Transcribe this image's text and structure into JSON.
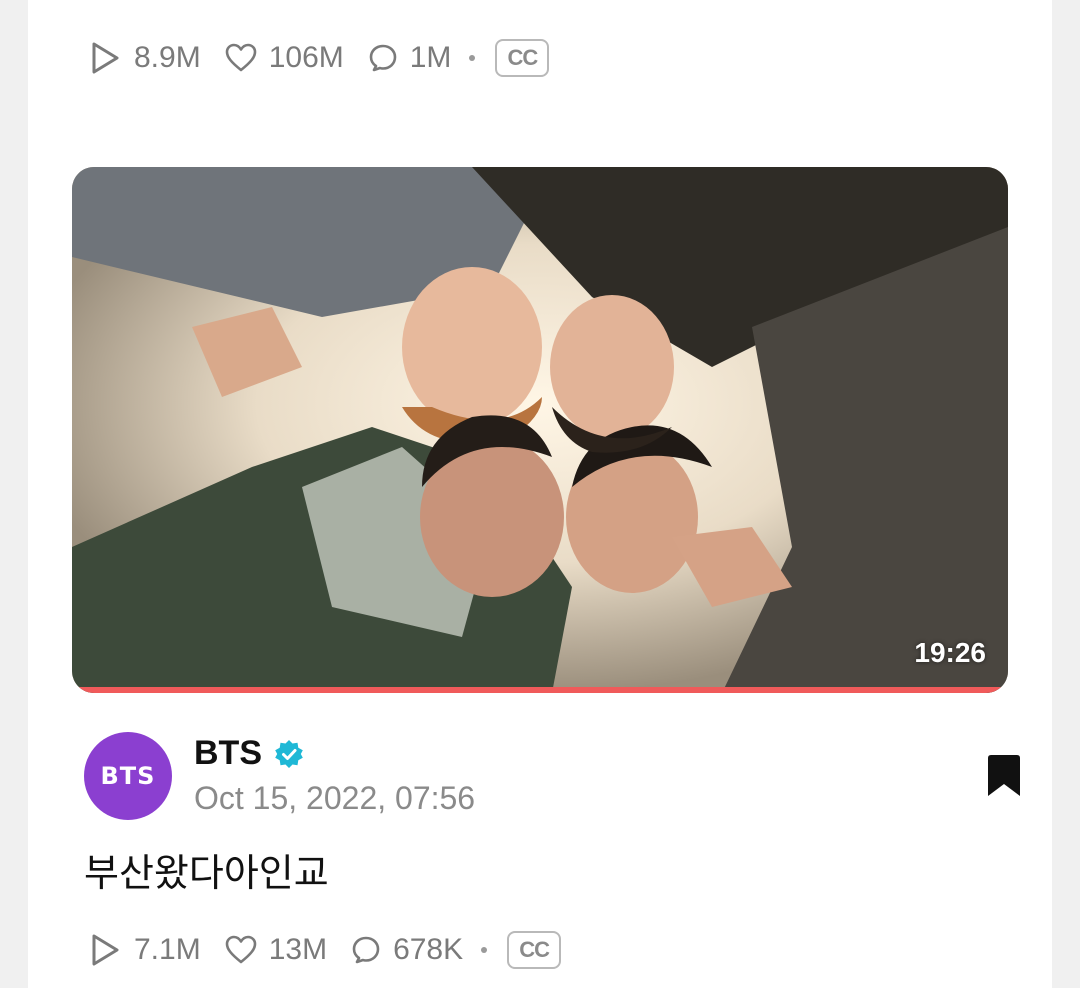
{
  "top_stats": {
    "plays": "8.9M",
    "likes": "106M",
    "comments": "1M",
    "cc_label": "CC"
  },
  "post": {
    "duration": "19:26",
    "progress_fraction": 1.0,
    "author": {
      "avatar_text": "BTS",
      "name": "BTS",
      "verified": true,
      "timestamp": "Oct 15, 2022, 07:56"
    },
    "caption": "부산왔다아인교",
    "stats": {
      "plays": "7.1M",
      "likes": "13M",
      "comments": "678K",
      "cc_label": "CC"
    }
  },
  "colors": {
    "avatar_bg": "#8b3fd0",
    "verified": "#1fb8d6",
    "progress": "#f05a5a"
  }
}
